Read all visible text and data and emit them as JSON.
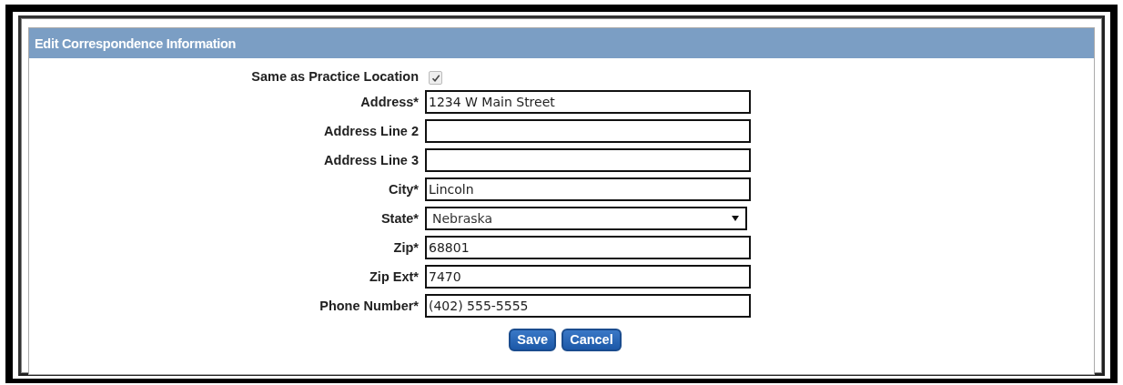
{
  "panel": {
    "title": "Edit Correspondence Information"
  },
  "fields": [
    {
      "kind": "checkbox",
      "label": "Same as Practice Location",
      "checked": true
    },
    {
      "kind": "text",
      "label": "Address*",
      "value": "1234 W Main Street"
    },
    {
      "kind": "text",
      "label": "Address Line 2"
    },
    {
      "kind": "text",
      "label": "Address Line 3"
    },
    {
      "kind": "text",
      "label": "City*",
      "value": "Lincoln"
    },
    {
      "kind": "select",
      "label": "State*",
      "value": "Nebraska"
    },
    {
      "kind": "text",
      "label": "Zip*",
      "value": "68801"
    },
    {
      "kind": "text",
      "label": "Zip Ext*",
      "value": "7470"
    },
    {
      "kind": "text",
      "label": "Phone Number*",
      "value": "(402) 555-5555"
    }
  ],
  "buttons": [
    "Save",
    "Cancel"
  ]
}
